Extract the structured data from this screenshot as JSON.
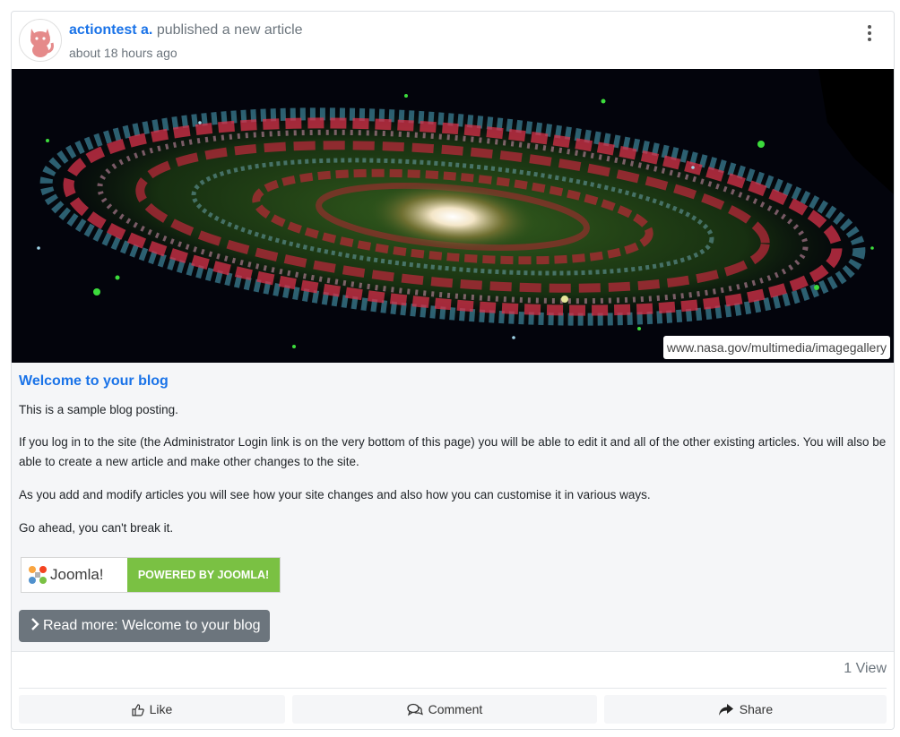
{
  "post": {
    "actor_name": "actiontest a.",
    "action_text": "published a new article",
    "timestamp": "about 18 hours ago",
    "image_credit": "www.nasa.gov/multimedia/imagegallery"
  },
  "article": {
    "title": "Welcome to your blog",
    "paragraphs": [
      "This is a sample blog posting.",
      "If you log in to the site (the Administrator Login link is on the very bottom of this page) you will be able to edit it and all of the other existing articles. You will also be able to create a new article and make other changes to the site.",
      "As you add and modify articles you will see how your site changes and also how you can customise it in various ways.",
      "Go ahead, you can't break it."
    ],
    "badge": {
      "logo_text": "Joomla!",
      "label": "POWERED BY JOOMLA!"
    },
    "read_more": "Read more: Welcome to your blog"
  },
  "stats": {
    "views": "1 View"
  },
  "actions": {
    "like": "Like",
    "comment": "Comment",
    "share": "Share"
  },
  "colors": {
    "link": "#1a73e8",
    "joomla_green": "#7ac143",
    "button_gray": "#6c757d"
  },
  "icons": [
    "cat-avatar-icon",
    "kebab-menu-icon",
    "chevron-right-icon",
    "thumbs-up-icon",
    "comment-icon",
    "share-icon",
    "joomla-logo-icon"
  ]
}
